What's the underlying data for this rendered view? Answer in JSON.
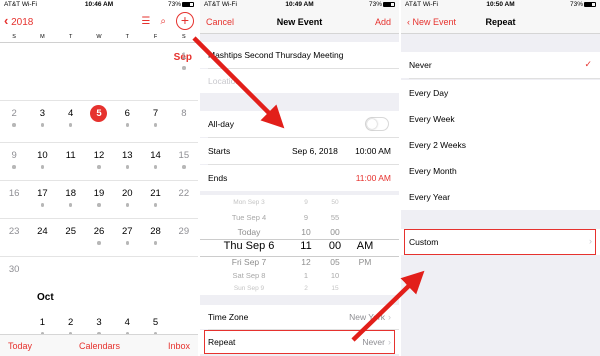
{
  "panel1": {
    "status": {
      "carrier": "AT&T Wi-Fi",
      "time": "10:46 AM",
      "battery": "73%"
    },
    "back_label": "2018",
    "weekdays": [
      "S",
      "M",
      "T",
      "W",
      "T",
      "F",
      "S"
    ],
    "months": {
      "current": "Sep",
      "next": "Oct"
    },
    "rows": [
      [
        {
          "d": ""
        },
        {
          "d": ""
        },
        {
          "d": ""
        },
        {
          "d": ""
        },
        {
          "d": ""
        },
        {
          "d": ""
        },
        {
          "d": "1",
          "dot": true
        }
      ],
      [
        {
          "d": "2",
          "dot": true
        },
        {
          "d": "3",
          "dot": true
        },
        {
          "d": "4",
          "dot": true
        },
        {
          "d": "5",
          "today": true
        },
        {
          "d": "6",
          "dot": true
        },
        {
          "d": "7",
          "dot": true
        },
        {
          "d": "8"
        }
      ],
      [
        {
          "d": "9",
          "dot": true
        },
        {
          "d": "10",
          "dot": true
        },
        {
          "d": "11"
        },
        {
          "d": "12",
          "dot": true
        },
        {
          "d": "13",
          "dot": true
        },
        {
          "d": "14",
          "dot": true
        },
        {
          "d": "15",
          "dot": true
        }
      ],
      [
        {
          "d": "16"
        },
        {
          "d": "17",
          "dot": true
        },
        {
          "d": "18",
          "dot": true
        },
        {
          "d": "19",
          "dot": true
        },
        {
          "d": "20",
          "dot": true
        },
        {
          "d": "21",
          "dot": true
        },
        {
          "d": "22"
        }
      ],
      [
        {
          "d": "23"
        },
        {
          "d": "24"
        },
        {
          "d": "25"
        },
        {
          "d": "26",
          "dot": true
        },
        {
          "d": "27",
          "dot": true
        },
        {
          "d": "28",
          "dot": true
        },
        {
          "d": "29"
        }
      ],
      [
        {
          "d": "30"
        },
        {
          "d": ""
        },
        {
          "d": ""
        },
        {
          "d": ""
        },
        {
          "d": ""
        },
        {
          "d": ""
        },
        {
          "d": ""
        }
      ],
      [
        {
          "d": ""
        },
        {
          "d": "1",
          "dot": true
        },
        {
          "d": "2",
          "dot": true
        },
        {
          "d": "3",
          "dot": true
        },
        {
          "d": "4",
          "dot": true
        },
        {
          "d": "5",
          "dot": true
        },
        {
          "d": ""
        }
      ]
    ],
    "tabs": {
      "today": "Today",
      "calendars": "Calendars",
      "inbox": "Inbox"
    }
  },
  "panel2": {
    "status": {
      "carrier": "AT&T Wi-Fi",
      "time": "10:49 AM",
      "battery": "73%"
    },
    "nav": {
      "cancel": "Cancel",
      "title": "New Event",
      "add": "Add"
    },
    "title_value": "Mashtips Second Thursday Meeting",
    "location_placeholder": "Location",
    "allday_label": "All-day",
    "starts_label": "Starts",
    "starts_date": "Sep 6, 2018",
    "starts_time": "10:00 AM",
    "ends_label": "Ends",
    "ends_time": "11:00 AM",
    "picker": [
      {
        "date": "Mon Sep 3",
        "hour": "9",
        "min": "50",
        "ampm": ""
      },
      {
        "date": "Tue Sep 4",
        "hour": "9",
        "min": "55",
        "ampm": ""
      },
      {
        "date": "Today",
        "hour": "10",
        "min": "00",
        "ampm": ""
      },
      {
        "date": "Thu Sep 6",
        "hour": "11",
        "min": "00",
        "ampm": "AM",
        "selected": true
      },
      {
        "date": "Fri Sep 7",
        "hour": "12",
        "min": "05",
        "ampm": "PM"
      },
      {
        "date": "Sat Sep 8",
        "hour": "1",
        "min": "10",
        "ampm": ""
      },
      {
        "date": "Sun Sep 9",
        "hour": "2",
        "min": "15",
        "ampm": ""
      }
    ],
    "timezone_label": "Time Zone",
    "timezone_value": "New York",
    "repeat_label": "Repeat",
    "repeat_value": "Never"
  },
  "panel3": {
    "status": {
      "carrier": "AT&T Wi-Fi",
      "time": "10:50 AM",
      "battery": "73%"
    },
    "nav": {
      "back": "New Event",
      "title": "Repeat"
    },
    "options": [
      "Never",
      "Every Day",
      "Every Week",
      "Every 2 Weeks",
      "Every Month",
      "Every Year"
    ],
    "selected": "Never",
    "custom_label": "Custom"
  },
  "colors": {
    "accent": "#e6322e",
    "arrow": "#e21f1a"
  },
  "icons": [
    "back-chevron-icon",
    "list-icon",
    "search-icon",
    "add-icon",
    "wifi-icon",
    "checkmark-icon",
    "chevron-right-icon"
  ]
}
